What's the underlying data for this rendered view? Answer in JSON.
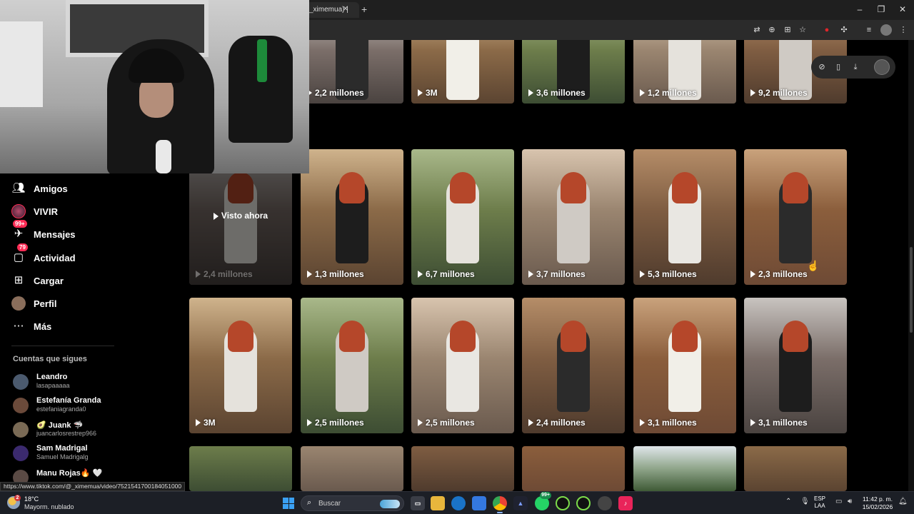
{
  "browser": {
    "tab_title": "_ximemua) |",
    "tab_close": "×",
    "new_tab": "+",
    "status_url": "https://www.tiktok.com/@_ximemua/video/7521541700184051000"
  },
  "sidebar": {
    "nav": [
      {
        "label": "Amigos",
        "icon": "friends-icon"
      },
      {
        "label": "VIVIR",
        "icon": "live-icon"
      },
      {
        "label": "Mensajes",
        "icon": "messages-icon",
        "badge": "99+"
      },
      {
        "label": "Actividad",
        "icon": "activity-icon",
        "badge": "79"
      },
      {
        "label": "Cargar",
        "icon": "upload-icon"
      },
      {
        "label": "Perfil",
        "icon": "profile-avatar"
      },
      {
        "label": "Más",
        "icon": "more-icon"
      }
    ],
    "following_title": "Cuentas que sigues",
    "following": [
      {
        "name": "Leandro",
        "handle": "lasapaaaaa"
      },
      {
        "name": "Estefanía Granda",
        "handle": "estefaniagranda0"
      },
      {
        "name": "🥑 Juank 🦈",
        "handle": "juancarlosrestrep966"
      },
      {
        "name": "Sam Madrigal",
        "handle": "Samuel Madrigalg"
      },
      {
        "name": "Manu Rojas🔥 🤍",
        "handle": ""
      }
    ]
  },
  "grid": {
    "watched_label": "Visto ahora",
    "rows": [
      [
        "",
        "2,2 millones",
        "3M",
        "3,6 millones",
        "1,2 millones",
        "9,2 millones"
      ],
      [
        "2,4 millones",
        "1,3 millones",
        "6,7 millones",
        "3,7 millones",
        "5,3 millones",
        "2,3 millones"
      ],
      [
        "3M",
        "2,5 millones",
        "2,5 millones",
        "2,4 millones",
        "3,1 millones",
        "3,1 millones"
      ]
    ]
  },
  "taskbar": {
    "weather_temp": "18°C",
    "weather_desc": "Mayorm. nublado",
    "weather_badge": "2",
    "search_placeholder": "Buscar",
    "whatsapp_badge": "99+",
    "lang_1": "ESP",
    "lang_2": "LAA",
    "time": "11:42 p. m.",
    "date": "15/02/2026"
  },
  "colors": {
    "accent": "#fe2c55",
    "background": "#000000",
    "taskbar": "#1c1f26"
  }
}
